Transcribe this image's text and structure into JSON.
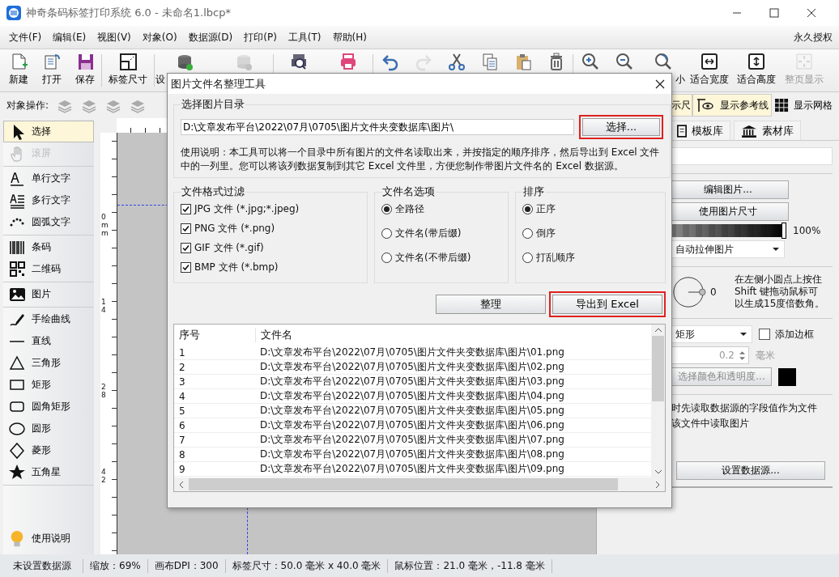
{
  "window": {
    "title": "神奇条码标签打印系统 6.0 - 未命名1.lbcp*"
  },
  "menu": {
    "items": [
      "文件(F)",
      "编辑(E)",
      "视图(V)",
      "对象(O)",
      "数据源(D)",
      "打印(P)",
      "工具(T)",
      "帮助(H)"
    ],
    "license": "永久授权"
  },
  "toolbar": [
    [
      {
        "label": "新建",
        "disabled": false
      },
      {
        "label": "打开",
        "disabled": false
      },
      {
        "label": "保存",
        "disabled": false
      }
    ],
    [
      {
        "label": "标签尺寸",
        "disabled": false
      }
    ],
    [
      {
        "label": "设",
        "disabled": false
      },
      {
        "disabled": true
      }
    ],
    [
      {
        "disabled": false
      },
      {
        "disabled": false
      }
    ],
    [
      {
        "disabled": false
      },
      {
        "disabled": true
      },
      {
        "disabled": false
      },
      {
        "disabled": false
      },
      {
        "disabled": false
      },
      {
        "disabled": false
      }
    ],
    [
      {
        "disabled": false
      },
      {
        "disabled": false
      },
      {
        "label": "小",
        "disabled": false
      },
      {
        "label": "适合宽度",
        "disabled": false
      },
      {
        "label": "适合高度",
        "disabled": false
      },
      {
        "label": "整页显示",
        "disabled": true
      }
    ]
  ],
  "object_ops": {
    "label": "对象操作:",
    "tools": [
      {
        "disabled": true
      },
      {
        "disabled": true
      },
      {
        "disabled": true
      },
      {
        "disabled": true
      }
    ]
  },
  "view_toggles": [
    {
      "label": "示尺",
      "on": true
    },
    {
      "label": "显示参考线",
      "on": true
    },
    {
      "label": "显示网格",
      "on": false
    }
  ],
  "toolbox": {
    "groups": [
      [
        {
          "label": "选择",
          "selected": true,
          "disabled": false
        },
        {
          "label": "滚屏",
          "selected": false,
          "disabled": true
        }
      ],
      [
        {
          "label": "单行文字",
          "selected": false,
          "disabled": false
        },
        {
          "label": "多行文字",
          "selected": false,
          "disabled": false
        },
        {
          "label": "圆弧文字",
          "selected": false,
          "disabled": false
        }
      ],
      [
        {
          "label": "条码",
          "selected": false,
          "disabled": false
        },
        {
          "label": "二维码",
          "selected": false,
          "disabled": false
        }
      ],
      [
        {
          "label": "图片",
          "selected": false,
          "disabled": false
        }
      ],
      [
        {
          "label": "手绘曲线",
          "selected": false,
          "disabled": false
        },
        {
          "label": "直线",
          "selected": false,
          "disabled": false
        },
        {
          "label": "三角形",
          "selected": false,
          "disabled": false
        },
        {
          "label": "矩形",
          "selected": false,
          "disabled": false
        },
        {
          "label": "圆角矩形",
          "selected": false,
          "disabled": false
        },
        {
          "label": "圆形",
          "selected": false,
          "disabled": false
        },
        {
          "label": "菱形",
          "selected": false,
          "disabled": false
        },
        {
          "label": "五角星",
          "selected": false,
          "disabled": false
        }
      ]
    ],
    "help": "使用说明"
  },
  "canvas": {
    "ruler_labels": [
      "0mm",
      "14",
      "28",
      "42"
    ]
  },
  "right_panel": {
    "tabs": [
      {
        "label": "模板库"
      },
      {
        "label": "素材库"
      }
    ],
    "edit_button": "编辑图片...",
    "size_button": "使用图片尺寸",
    "opacity": {
      "level": 1,
      "reading": "100%"
    },
    "stretch": "自动拉伸图片",
    "rotation": {
      "value": "0",
      "hint": "在左侧小圆点上按住 Shift 键拖动鼠标可以生成15度倍数角。"
    },
    "border_shape": "矩形",
    "add_border": {
      "label": "添加边框",
      "checked": false
    },
    "border_width": {
      "value": "0.2",
      "unit": "毫米",
      "disabled": true
    },
    "color_button": {
      "label": "选择颜色和透明度...",
      "disabled": true
    },
    "source_note": [
      "时先读取数据源的字段值作为文件",
      "该文件中读取图片"
    ],
    "source_button": "设置数据源..."
  },
  "status_bar": [
    "未设置数据源",
    "缩放：69%",
    "画布DPI：300",
    "标签尺寸：50.0 毫米 x 40.0 毫米",
    "鼠标位置：21.0 毫米，-11.8 毫米"
  ],
  "dialog": {
    "title": "图片文件名整理工具",
    "folder": {
      "legend": "选择图片目录",
      "path": "D:\\文章发布平台\\2022\\07月\\0705\\图片文件夹变数据库\\图片\\",
      "button": {
        "label": "选择...",
        "highlighted": true
      },
      "note": "使用说明：本工具可以将一个目录中所有图片的文件名读取出来，并按指定的顺序排序，然后导出到 Excel 文件中的一列里。您可以将该列数据复制到其它 Excel 文件里，方便您制作带图片文件名的 Excel 数据源。"
    },
    "filters": {
      "legend": "文件格式过滤",
      "items": [
        {
          "label": "JPG 文件 (*.jpg;*.jpeg)",
          "checked": true
        },
        {
          "label": "PNG 文件 (*.png)",
          "checked": true
        },
        {
          "label": "GIF 文件 (*.gif)",
          "checked": true
        },
        {
          "label": "BMP 文件 (*.bmp)",
          "checked": true
        }
      ]
    },
    "name_options": {
      "legend": "文件名选项",
      "items": [
        {
          "label": "全路径",
          "selected": true
        },
        {
          "label": "文件名(带后缀)",
          "selected": false
        },
        {
          "label": "文件名(不带后缀)",
          "selected": false
        }
      ]
    },
    "order": {
      "legend": "排序",
      "items": [
        {
          "label": "正序",
          "selected": true
        },
        {
          "label": "倒序",
          "selected": false
        },
        {
          "label": "打乱顺序",
          "selected": false
        }
      ]
    },
    "buttons": [
      {
        "label": "整理",
        "highlighted": false
      },
      {
        "label": "导出到 Excel",
        "highlighted": true
      }
    ],
    "table": {
      "columns": [
        "序号",
        "文件名"
      ],
      "rows": [
        [
          "1",
          "D:\\文章发布平台\\2022\\07月\\0705\\图片文件夹变数据库\\图片\\01.png"
        ],
        [
          "2",
          "D:\\文章发布平台\\2022\\07月\\0705\\图片文件夹变数据库\\图片\\02.png"
        ],
        [
          "3",
          "D:\\文章发布平台\\2022\\07月\\0705\\图片文件夹变数据库\\图片\\03.png"
        ],
        [
          "4",
          "D:\\文章发布平台\\2022\\07月\\0705\\图片文件夹变数据库\\图片\\04.png"
        ],
        [
          "5",
          "D:\\文章发布平台\\2022\\07月\\0705\\图片文件夹变数据库\\图片\\05.png"
        ],
        [
          "6",
          "D:\\文章发布平台\\2022\\07月\\0705\\图片文件夹变数据库\\图片\\06.png"
        ],
        [
          "7",
          "D:\\文章发布平台\\2022\\07月\\0705\\图片文件夹变数据库\\图片\\07.png"
        ],
        [
          "8",
          "D:\\文章发布平台\\2022\\07月\\0705\\图片文件夹变数据库\\图片\\08.png"
        ],
        [
          "9",
          "D:\\文章发布平台\\2022\\07月\\0705\\图片文件夹变数据库\\图片\\09.png"
        ]
      ]
    }
  }
}
